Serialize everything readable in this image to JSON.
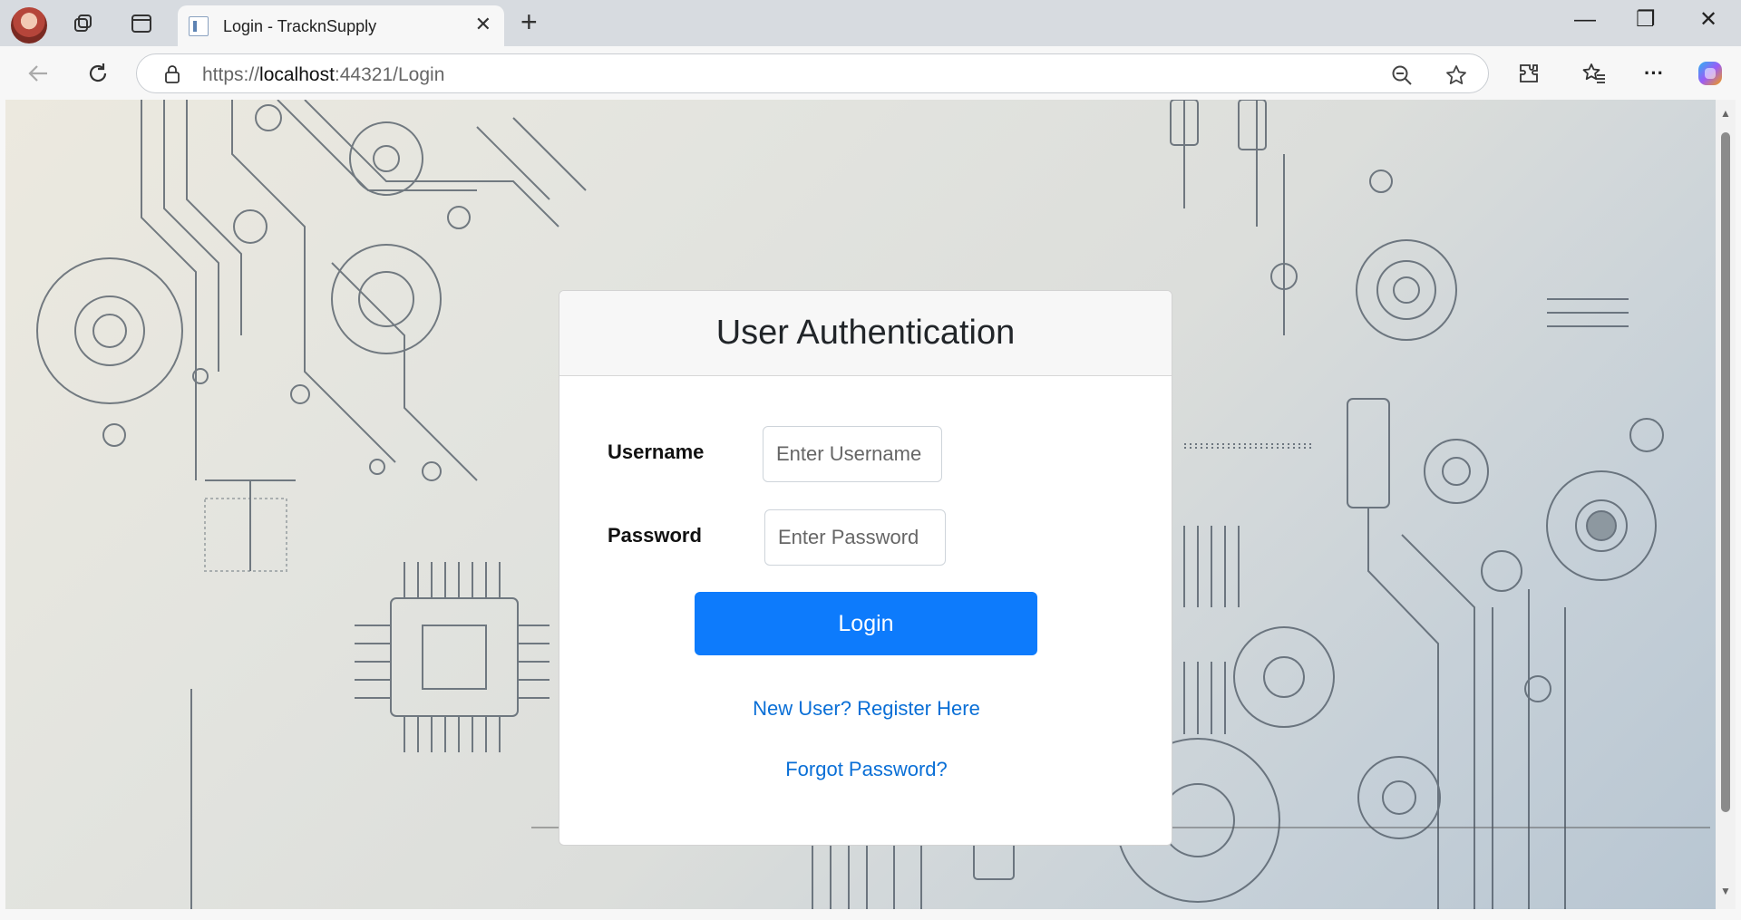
{
  "browser": {
    "tab_title": "Login - TracknSupply",
    "url_prefix": "https://",
    "url_host": "localhost",
    "url_rest": ":44321/Login",
    "icons": [
      "profile-avatar",
      "workspaces-icon",
      "tab-actions-icon",
      "close-icon",
      "plus-icon",
      "minimize-icon",
      "restore-icon",
      "close-window-icon",
      "back-icon",
      "refresh-icon",
      "lock-icon",
      "zoom-out-icon",
      "favorite-star-icon",
      "extensions-icon",
      "favorites-icon",
      "more-icon",
      "copilot-icon"
    ]
  },
  "login": {
    "heading": "User Authentication",
    "username_label": "Username",
    "username_placeholder": "Enter Username",
    "password_label": "Password",
    "password_placeholder": "Enter Password",
    "login_button": "Login",
    "register_link": "New User? Register Here",
    "forgot_link": "Forgot Password?"
  },
  "colors": {
    "primary_button": "#0d7bfc",
    "link": "#0a6fd6"
  }
}
